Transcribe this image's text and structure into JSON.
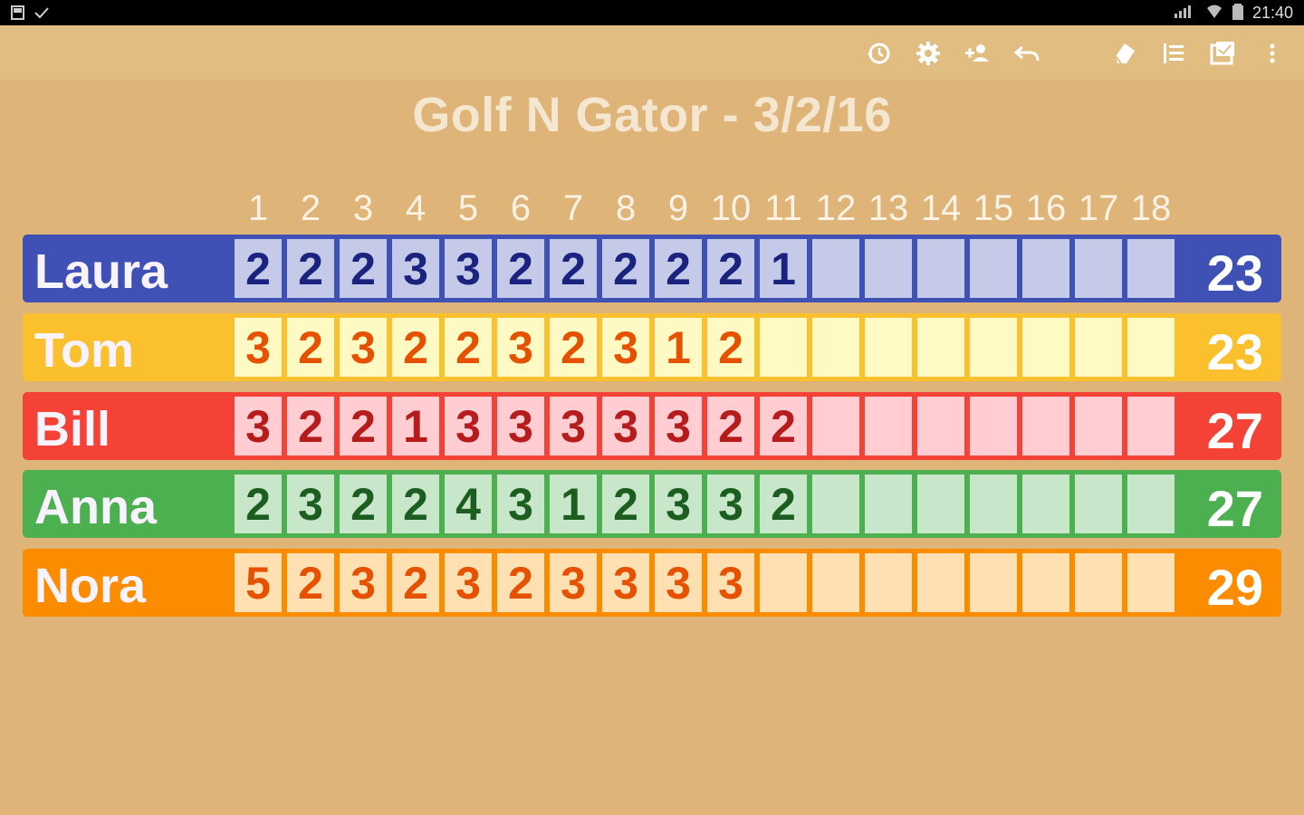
{
  "status_bar": {
    "time": "21:40",
    "icons": [
      "sd-card-icon",
      "check-icon",
      "signal-icon",
      "wifi-icon",
      "battery-icon"
    ]
  },
  "toolbar": {
    "actions": [
      "history-icon",
      "settings-icon",
      "add-player-icon",
      "undo-icon",
      "clear-icon",
      "list-icon",
      "scorecard-icon",
      "more-vert-icon"
    ]
  },
  "title": "Golf N Gator - 3/2/16",
  "holes": [
    "1",
    "2",
    "3",
    "4",
    "5",
    "6",
    "7",
    "8",
    "9",
    "10",
    "11",
    "12",
    "13",
    "14",
    "15",
    "16",
    "17",
    "18"
  ],
  "players": [
    {
      "name": "Laura",
      "scores": [
        "2",
        "2",
        "2",
        "3",
        "3",
        "2",
        "2",
        "2",
        "2",
        "2",
        "1",
        "",
        "",
        "",
        "",
        "",
        "",
        ""
      ],
      "total": "23",
      "colors": {
        "row": "#3f51b5",
        "cell": "#c5cae9",
        "text": "#1a237e",
        "border": "#3f51b5"
      }
    },
    {
      "name": "Tom",
      "scores": [
        "3",
        "2",
        "3",
        "2",
        "2",
        "3",
        "2",
        "3",
        "1",
        "2",
        "",
        "",
        "",
        "",
        "",
        "",
        "",
        ""
      ],
      "total": "23",
      "colors": {
        "row": "#fbc02d",
        "cell": "#fff9c4",
        "text": "#e65100",
        "border": "#fbc02d"
      }
    },
    {
      "name": "Bill",
      "scores": [
        "3",
        "2",
        "2",
        "1",
        "3",
        "3",
        "3",
        "3",
        "3",
        "2",
        "2",
        "",
        "",
        "",
        "",
        "",
        "",
        ""
      ],
      "total": "27",
      "colors": {
        "row": "#f44336",
        "cell": "#ffcdd2",
        "text": "#b71c1c",
        "border": "#f44336"
      }
    },
    {
      "name": "Anna",
      "scores": [
        "2",
        "3",
        "2",
        "2",
        "4",
        "3",
        "1",
        "2",
        "3",
        "3",
        "2",
        "",
        "",
        "",
        "",
        "",
        "",
        ""
      ],
      "total": "27",
      "colors": {
        "row": "#4caf50",
        "cell": "#c8e6c9",
        "text": "#1b5e20",
        "border": "#4caf50"
      }
    },
    {
      "name": "Nora",
      "scores": [
        "5",
        "2",
        "3",
        "2",
        "3",
        "2",
        "3",
        "3",
        "3",
        "3",
        "",
        "",
        "",
        "",
        "",
        "",
        "",
        ""
      ],
      "total": "29",
      "colors": {
        "row": "#fb8c00",
        "cell": "#ffe0b2",
        "text": "#e65100",
        "border": "#fb8c00"
      }
    }
  ]
}
